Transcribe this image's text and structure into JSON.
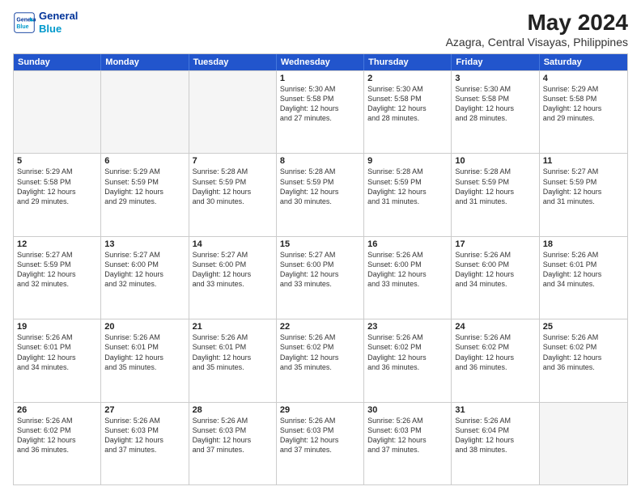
{
  "header": {
    "logo_line1": "General",
    "logo_line2": "Blue",
    "title": "May 2024",
    "subtitle": "Azagra, Central Visayas, Philippines"
  },
  "days_of_week": [
    "Sunday",
    "Monday",
    "Tuesday",
    "Wednesday",
    "Thursday",
    "Friday",
    "Saturday"
  ],
  "weeks": [
    [
      {
        "day": "",
        "info": "",
        "empty": true
      },
      {
        "day": "",
        "info": "",
        "empty": true
      },
      {
        "day": "",
        "info": "",
        "empty": true
      },
      {
        "day": "1",
        "info": "Sunrise: 5:30 AM\nSunset: 5:58 PM\nDaylight: 12 hours\nand 27 minutes.",
        "empty": false
      },
      {
        "day": "2",
        "info": "Sunrise: 5:30 AM\nSunset: 5:58 PM\nDaylight: 12 hours\nand 28 minutes.",
        "empty": false
      },
      {
        "day": "3",
        "info": "Sunrise: 5:30 AM\nSunset: 5:58 PM\nDaylight: 12 hours\nand 28 minutes.",
        "empty": false
      },
      {
        "day": "4",
        "info": "Sunrise: 5:29 AM\nSunset: 5:58 PM\nDaylight: 12 hours\nand 29 minutes.",
        "empty": false
      }
    ],
    [
      {
        "day": "5",
        "info": "Sunrise: 5:29 AM\nSunset: 5:58 PM\nDaylight: 12 hours\nand 29 minutes.",
        "empty": false
      },
      {
        "day": "6",
        "info": "Sunrise: 5:29 AM\nSunset: 5:59 PM\nDaylight: 12 hours\nand 29 minutes.",
        "empty": false
      },
      {
        "day": "7",
        "info": "Sunrise: 5:28 AM\nSunset: 5:59 PM\nDaylight: 12 hours\nand 30 minutes.",
        "empty": false
      },
      {
        "day": "8",
        "info": "Sunrise: 5:28 AM\nSunset: 5:59 PM\nDaylight: 12 hours\nand 30 minutes.",
        "empty": false
      },
      {
        "day": "9",
        "info": "Sunrise: 5:28 AM\nSunset: 5:59 PM\nDaylight: 12 hours\nand 31 minutes.",
        "empty": false
      },
      {
        "day": "10",
        "info": "Sunrise: 5:28 AM\nSunset: 5:59 PM\nDaylight: 12 hours\nand 31 minutes.",
        "empty": false
      },
      {
        "day": "11",
        "info": "Sunrise: 5:27 AM\nSunset: 5:59 PM\nDaylight: 12 hours\nand 31 minutes.",
        "empty": false
      }
    ],
    [
      {
        "day": "12",
        "info": "Sunrise: 5:27 AM\nSunset: 5:59 PM\nDaylight: 12 hours\nand 32 minutes.",
        "empty": false
      },
      {
        "day": "13",
        "info": "Sunrise: 5:27 AM\nSunset: 6:00 PM\nDaylight: 12 hours\nand 32 minutes.",
        "empty": false
      },
      {
        "day": "14",
        "info": "Sunrise: 5:27 AM\nSunset: 6:00 PM\nDaylight: 12 hours\nand 33 minutes.",
        "empty": false
      },
      {
        "day": "15",
        "info": "Sunrise: 5:27 AM\nSunset: 6:00 PM\nDaylight: 12 hours\nand 33 minutes.",
        "empty": false
      },
      {
        "day": "16",
        "info": "Sunrise: 5:26 AM\nSunset: 6:00 PM\nDaylight: 12 hours\nand 33 minutes.",
        "empty": false
      },
      {
        "day": "17",
        "info": "Sunrise: 5:26 AM\nSunset: 6:00 PM\nDaylight: 12 hours\nand 34 minutes.",
        "empty": false
      },
      {
        "day": "18",
        "info": "Sunrise: 5:26 AM\nSunset: 6:01 PM\nDaylight: 12 hours\nand 34 minutes.",
        "empty": false
      }
    ],
    [
      {
        "day": "19",
        "info": "Sunrise: 5:26 AM\nSunset: 6:01 PM\nDaylight: 12 hours\nand 34 minutes.",
        "empty": false
      },
      {
        "day": "20",
        "info": "Sunrise: 5:26 AM\nSunset: 6:01 PM\nDaylight: 12 hours\nand 35 minutes.",
        "empty": false
      },
      {
        "day": "21",
        "info": "Sunrise: 5:26 AM\nSunset: 6:01 PM\nDaylight: 12 hours\nand 35 minutes.",
        "empty": false
      },
      {
        "day": "22",
        "info": "Sunrise: 5:26 AM\nSunset: 6:02 PM\nDaylight: 12 hours\nand 35 minutes.",
        "empty": false
      },
      {
        "day": "23",
        "info": "Sunrise: 5:26 AM\nSunset: 6:02 PM\nDaylight: 12 hours\nand 36 minutes.",
        "empty": false
      },
      {
        "day": "24",
        "info": "Sunrise: 5:26 AM\nSunset: 6:02 PM\nDaylight: 12 hours\nand 36 minutes.",
        "empty": false
      },
      {
        "day": "25",
        "info": "Sunrise: 5:26 AM\nSunset: 6:02 PM\nDaylight: 12 hours\nand 36 minutes.",
        "empty": false
      }
    ],
    [
      {
        "day": "26",
        "info": "Sunrise: 5:26 AM\nSunset: 6:02 PM\nDaylight: 12 hours\nand 36 minutes.",
        "empty": false
      },
      {
        "day": "27",
        "info": "Sunrise: 5:26 AM\nSunset: 6:03 PM\nDaylight: 12 hours\nand 37 minutes.",
        "empty": false
      },
      {
        "day": "28",
        "info": "Sunrise: 5:26 AM\nSunset: 6:03 PM\nDaylight: 12 hours\nand 37 minutes.",
        "empty": false
      },
      {
        "day": "29",
        "info": "Sunrise: 5:26 AM\nSunset: 6:03 PM\nDaylight: 12 hours\nand 37 minutes.",
        "empty": false
      },
      {
        "day": "30",
        "info": "Sunrise: 5:26 AM\nSunset: 6:03 PM\nDaylight: 12 hours\nand 37 minutes.",
        "empty": false
      },
      {
        "day": "31",
        "info": "Sunrise: 5:26 AM\nSunset: 6:04 PM\nDaylight: 12 hours\nand 38 minutes.",
        "empty": false
      },
      {
        "day": "",
        "info": "",
        "empty": true
      }
    ]
  ]
}
